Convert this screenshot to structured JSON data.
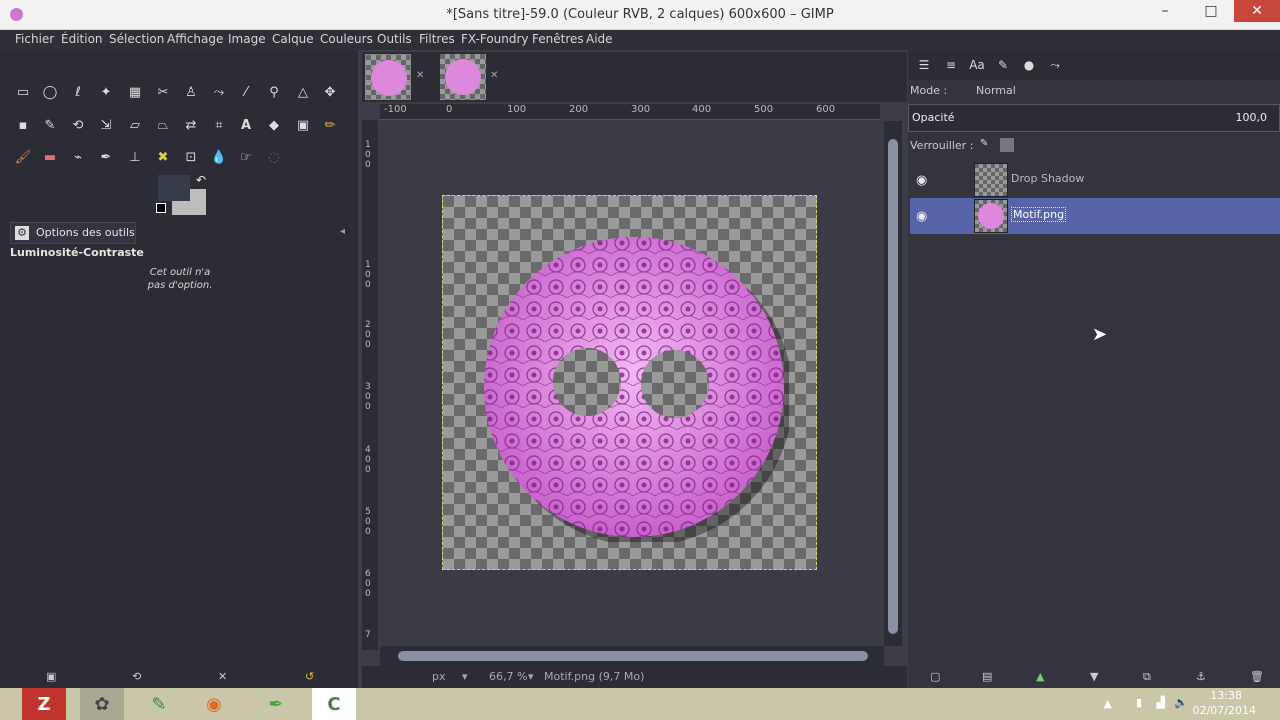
{
  "window": {
    "title": "*[Sans titre]-59.0 (Couleur RVB, 2 calques) 600x600 – GIMP",
    "minimize": "–",
    "maximize": "□",
    "close": "✕"
  },
  "menu": [
    "Fichier",
    "Édition",
    "Sélection",
    "Affichage",
    "Image",
    "Calque",
    "Couleurs",
    "Outils",
    "Filtres",
    "FX-Foundry",
    "Fenêtres",
    "Aide"
  ],
  "toolbox": {
    "tools": [
      "rect-select",
      "ellipse-select",
      "free-select",
      "fuzzy-select",
      "color-select",
      "scissors",
      "foreground-select",
      "paths",
      "color-picker",
      "zoom",
      "measure",
      "move",
      "align",
      "crop",
      "rotate",
      "scale",
      "shear",
      "perspective",
      "flip",
      "cage",
      "text",
      "bucket-fill",
      "blend",
      "pencil",
      "paintbrush",
      "eraser",
      "airbrush",
      "ink",
      "clone",
      "heal",
      "perspective-clone",
      "blur",
      "smudge",
      "dodge-burn"
    ],
    "fg_color": "#353d4a",
    "bg_color": "#bdbdbd"
  },
  "tool_options": {
    "tab_label": "Options des outils",
    "tool_name": "Luminosité-Contraste",
    "note_line1": "Cet outil n'a",
    "note_line2": "pas d'option."
  },
  "canvas": {
    "ruler_labels": [
      "-100",
      "0",
      "100",
      "200",
      "300",
      "400",
      "500",
      "600"
    ],
    "vruler_labels": [
      "1",
      "0",
      "0",
      "1",
      "0",
      "0",
      "2",
      "0",
      "0",
      "3",
      "0",
      "0",
      "4",
      "0",
      "0",
      "5",
      "0",
      "0",
      "6",
      "0",
      "0",
      "7"
    ]
  },
  "status": {
    "unit": "px",
    "zoom": "66,7 %",
    "info": "Motif.png (9,7 Mo)"
  },
  "layers": {
    "mode_label": "Mode :",
    "mode_value": "Normal",
    "opacity_label": "Opacité",
    "opacity_value": "100,0",
    "lock_label": "Verrouiller :",
    "items": [
      {
        "name": "Drop Shadow",
        "visible": true,
        "selected": false
      },
      {
        "name": "Motif.png",
        "visible": true,
        "selected": true
      }
    ]
  },
  "taskbar": {
    "apps": [
      "FileZilla",
      "GIMP",
      "Notepad++",
      "Firefox",
      "Stylus",
      "Camtasia"
    ],
    "time": "13:38",
    "date": "02/07/2014"
  }
}
